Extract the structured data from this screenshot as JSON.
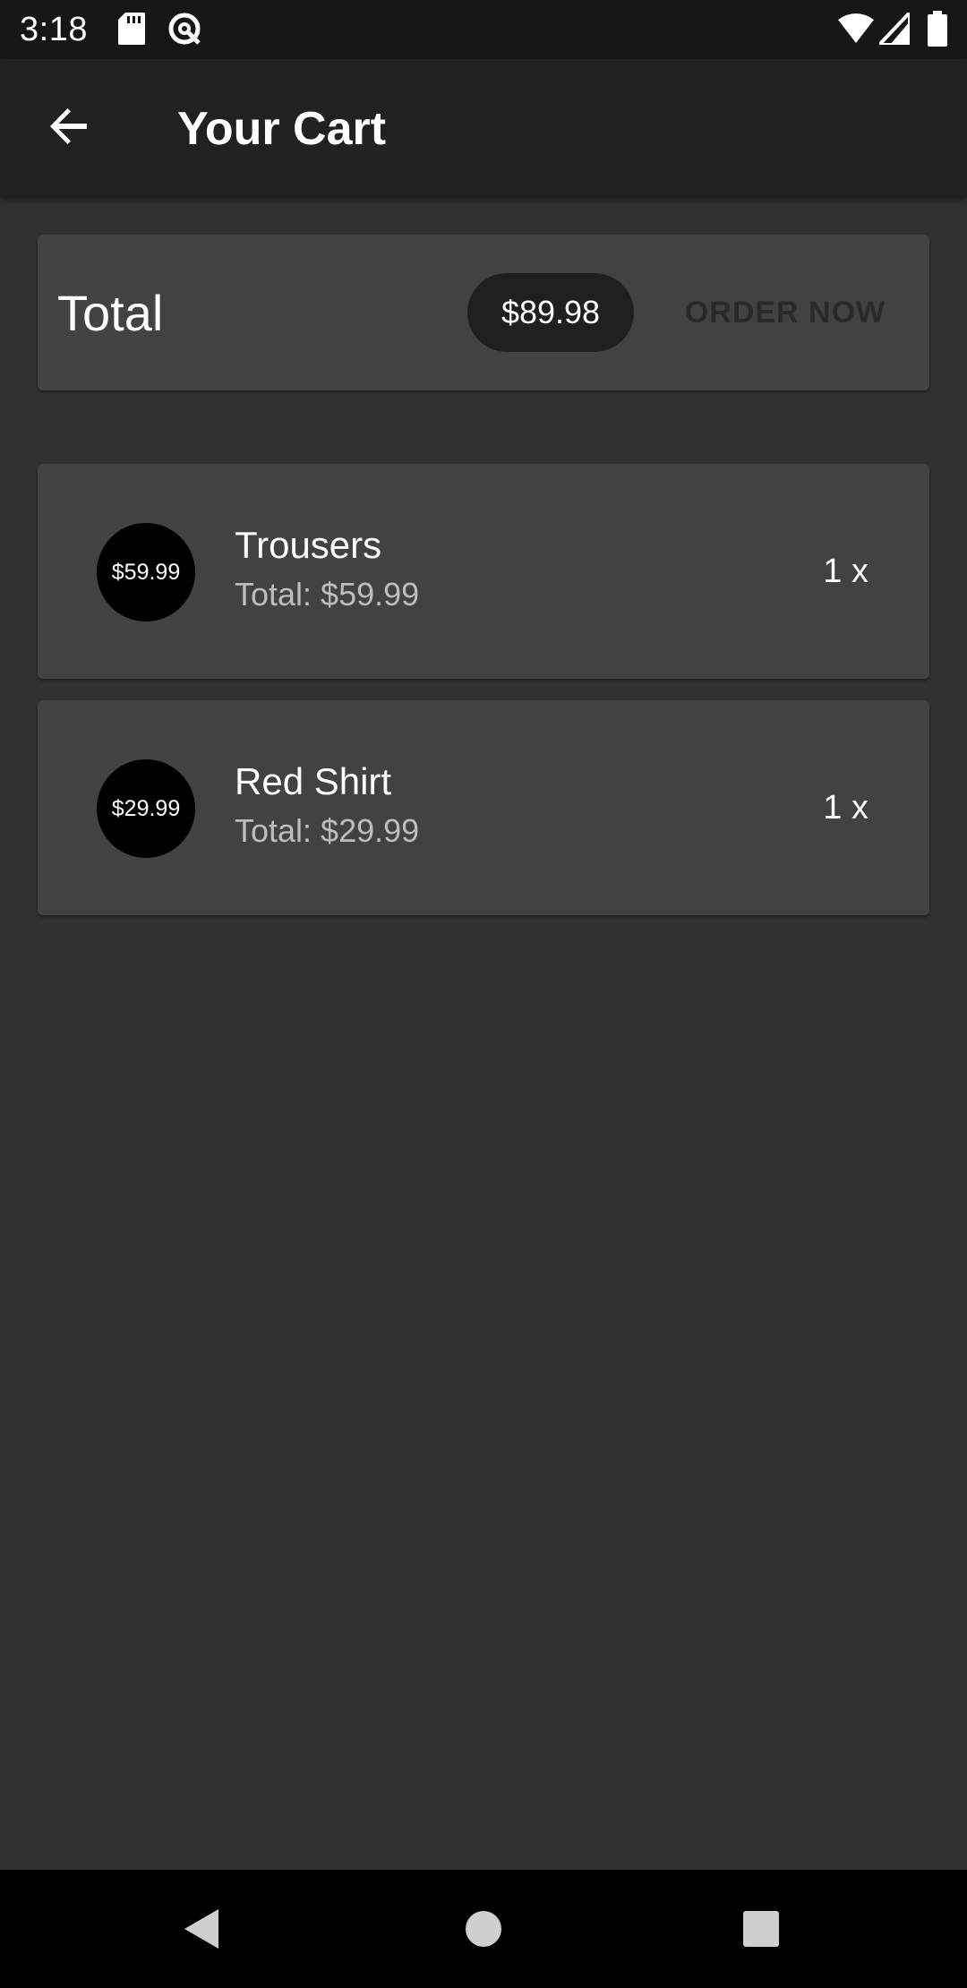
{
  "status_bar": {
    "time": "3:18",
    "icons": [
      "sd-card-icon",
      "data-saver-icon",
      "wifi-icon",
      "signal-icon",
      "battery-icon"
    ]
  },
  "app_bar": {
    "back_icon": "arrow-back-icon",
    "title": "Your Cart"
  },
  "summary": {
    "total_label": "Total",
    "total_amount": "$89.98",
    "order_button_label": "ORDER NOW"
  },
  "cart": {
    "items": [
      {
        "avatar_price": "$59.99",
        "name": "Trousers",
        "total": "Total: $59.99",
        "quantity": "1 x"
      },
      {
        "avatar_price": "$29.99",
        "name": "Red Shirt",
        "total": "Total: $29.99",
        "quantity": "1 x"
      }
    ]
  },
  "nav_bar": {
    "icons": [
      "back-triangle-icon",
      "home-circle-icon",
      "recents-square-icon"
    ]
  },
  "colors": {
    "background": "#303030",
    "app_bar": "#212121",
    "card": "#424242",
    "chip": "#1f1f1f",
    "order_text": "#2a2a2a",
    "secondary_text": "#bdbdbd"
  }
}
